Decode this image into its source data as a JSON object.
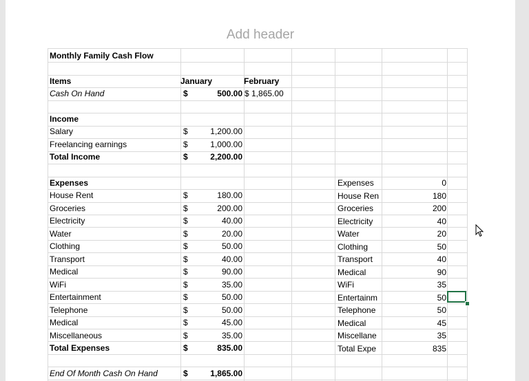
{
  "header_placeholder": "Add header",
  "sheet": {
    "title": "Monthly Family Cash Flow",
    "items_label": "Items",
    "months": [
      "January",
      "February"
    ],
    "cash_on_hand": {
      "label": "Cash On Hand",
      "jan_sym": "$",
      "jan": "500.00",
      "feb": "$ 1,865.00"
    },
    "income": {
      "label": "Income",
      "rows": [
        {
          "label": "Salary",
          "sym": "$",
          "value": "1,200.00"
        },
        {
          "label": "Freelancing earnings",
          "sym": "$",
          "value": "1,000.00"
        }
      ],
      "total": {
        "label": "Total Income",
        "sym": "$",
        "value": "2,200.00"
      }
    },
    "expenses": {
      "label": "Expenses",
      "rows": [
        {
          "label": "House Rent",
          "sym": "$",
          "value": "180.00"
        },
        {
          "label": "Groceries",
          "sym": "$",
          "value": "200.00"
        },
        {
          "label": "Electricity",
          "sym": "$",
          "value": "40.00"
        },
        {
          "label": "Water",
          "sym": "$",
          "value": "20.00"
        },
        {
          "label": "Clothing",
          "sym": "$",
          "value": "50.00"
        },
        {
          "label": "Transport",
          "sym": "$",
          "value": "40.00"
        },
        {
          "label": "Medical",
          "sym": "$",
          "value": "90.00"
        },
        {
          "label": "WiFi",
          "sym": "$",
          "value": "35.00"
        },
        {
          "label": "Entertainment",
          "sym": "$",
          "value": "50.00"
        },
        {
          "label": "Telephone",
          "sym": "$",
          "value": "50.00"
        },
        {
          "label": "Medical",
          "sym": "$",
          "value": "45.00"
        },
        {
          "label": "Miscellaneous",
          "sym": "$",
          "value": "35.00"
        }
      ],
      "total": {
        "label": "Total Expenses",
        "sym": "$",
        "value": "835.00"
      }
    },
    "end_cash": {
      "label": "End Of Month Cash On Hand",
      "sym": "$",
      "value": "1,865.00"
    },
    "side_table": [
      {
        "label": "Expenses",
        "value": "0"
      },
      {
        "label": "House Ren",
        "value": "180"
      },
      {
        "label": "Groceries",
        "value": "200"
      },
      {
        "label": "Electricity",
        "value": "40"
      },
      {
        "label": "Water",
        "value": "20"
      },
      {
        "label": "Clothing",
        "value": "50"
      },
      {
        "label": "Transport",
        "value": "40"
      },
      {
        "label": "Medical",
        "value": "90"
      },
      {
        "label": "WiFi",
        "value": "35"
      },
      {
        "label": "Entertainm",
        "value": "50"
      },
      {
        "label": "Telephone",
        "value": "50"
      },
      {
        "label": "Medical",
        "value": "45"
      },
      {
        "label": "Miscellane",
        "value": "35"
      },
      {
        "label": "Total Expe",
        "value": "835"
      }
    ]
  },
  "colors": {
    "selection": "#217346",
    "gridline": "#d9d9d9",
    "header_placeholder": "#a6a6a6"
  }
}
